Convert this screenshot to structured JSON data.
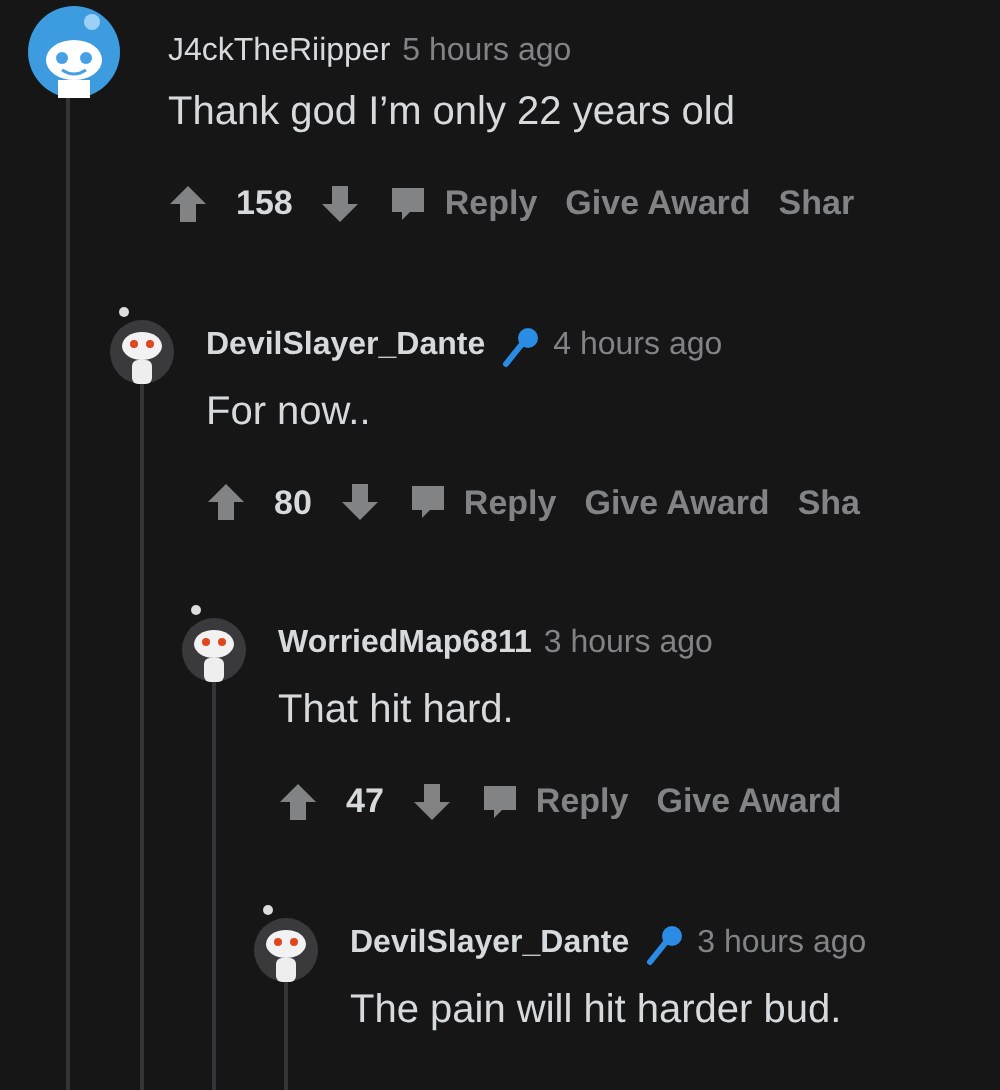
{
  "comments": [
    {
      "username": "J4ckTheRiipper",
      "mic_flair": false,
      "time": "5 hours ago",
      "body": "Thank god I’m only 22 years old",
      "votes": "158",
      "actions": [
        "Reply",
        "Give Award",
        "Shar"
      ],
      "children": [
        {
          "username": "DevilSlayer_Dante",
          "mic_flair": true,
          "time": "4 hours ago",
          "body": "For now..",
          "votes": "80",
          "actions": [
            "Reply",
            "Give Award",
            "Sha"
          ],
          "children": [
            {
              "username": "WorriedMap6811",
              "mic_flair": false,
              "time": "3 hours ago",
              "body": "That hit hard.",
              "votes": "47",
              "actions": [
                "Reply",
                "Give Award"
              ],
              "children": [
                {
                  "username": "DevilSlayer_Dante",
                  "mic_flair": true,
                  "time": "3 hours ago",
                  "body": "The pain will hit harder bud."
                }
              ]
            }
          ]
        }
      ]
    }
  ]
}
